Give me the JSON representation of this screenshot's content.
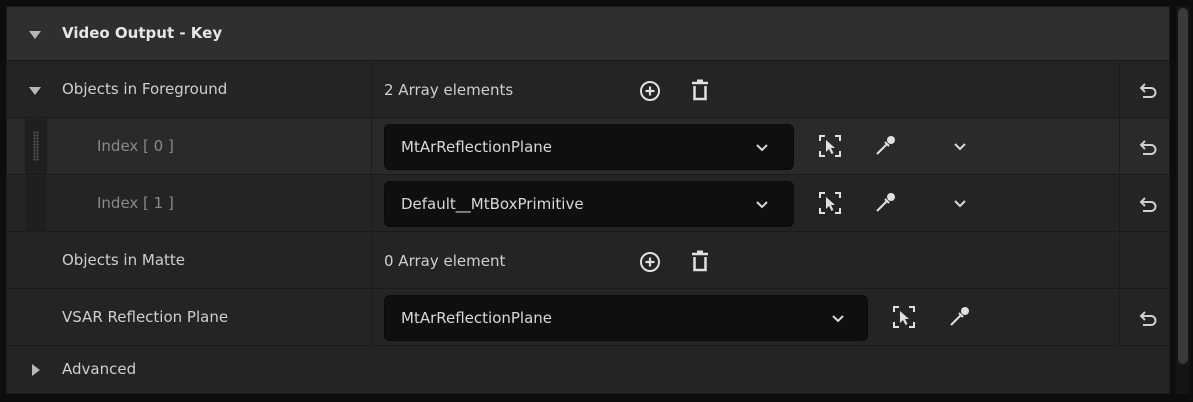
{
  "section": {
    "title": "Video Output - Key"
  },
  "rows": {
    "foreground": {
      "label": "Objects in Foreground",
      "value": "2 Array elements"
    },
    "index0": {
      "label": "Index [ 0 ]",
      "value": "MtArReflectionPlane"
    },
    "index1": {
      "label": "Index [ 1 ]",
      "value": "Default__MtBoxPrimitive"
    },
    "matte": {
      "label": "Objects in Matte",
      "value": "0 Array element"
    },
    "reflection": {
      "label": "VSAR Reflection Plane",
      "value": "MtArReflectionPlane"
    },
    "advanced": {
      "label": "Advanced"
    }
  },
  "colors": {
    "panel": "#242424",
    "header": "#2f2f2f",
    "field": "#0f0f0f",
    "text": "#cfcfcf"
  },
  "icons": [
    "add-element-icon",
    "delete-all-icon",
    "select-actor-icon",
    "eyedropper-icon",
    "chevron-down-icon",
    "reset-to-default-icon"
  ]
}
